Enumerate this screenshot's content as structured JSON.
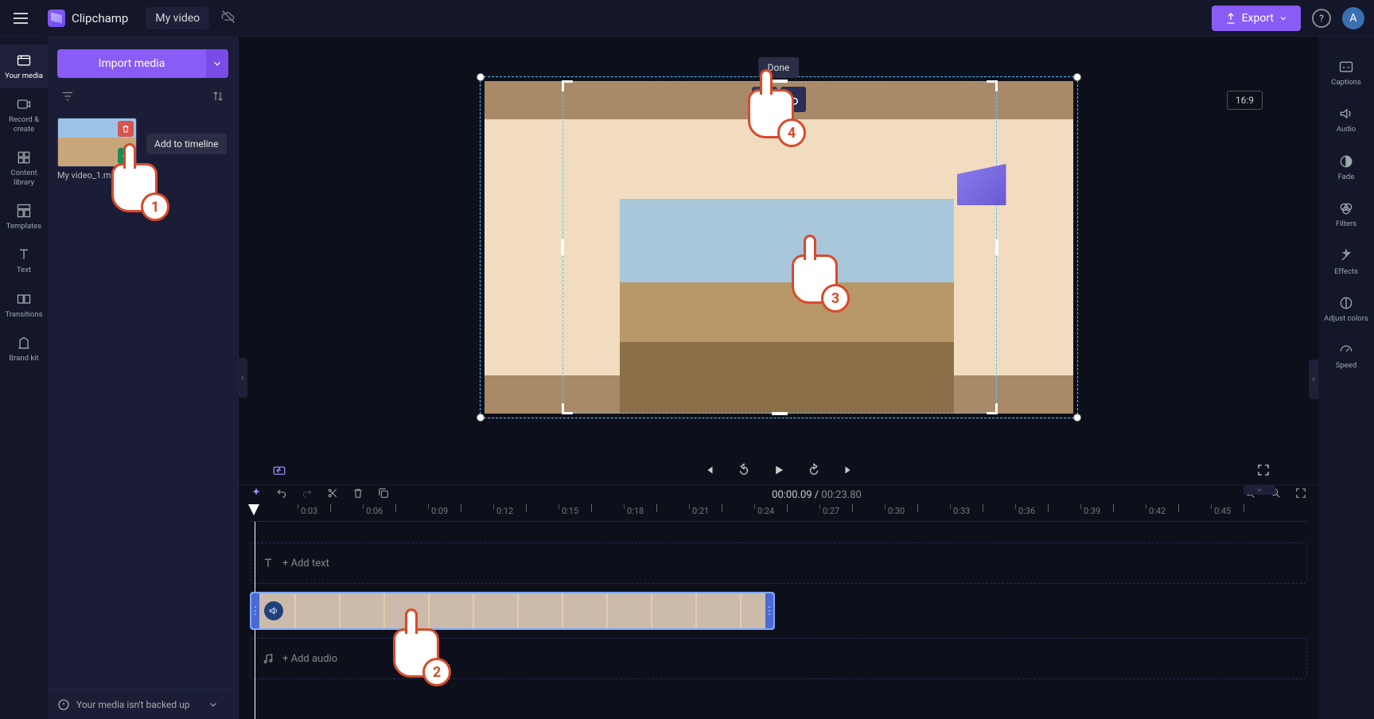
{
  "brand": "Clipchamp",
  "project": "My video",
  "done_tooltip": "Done",
  "export_label": "Export",
  "avatar_initial": "A",
  "navrail": [
    {
      "label": "Your media",
      "id": "your-media"
    },
    {
      "label": "Record & create",
      "id": "record-create"
    },
    {
      "label": "Content library",
      "id": "content-library"
    },
    {
      "label": "Templates",
      "id": "templates"
    },
    {
      "label": "Text",
      "id": "text"
    },
    {
      "label": "Transitions",
      "id": "transitions"
    },
    {
      "label": "Brand kit",
      "id": "brand-kit"
    }
  ],
  "import_label": "Import media",
  "media_item_name": "My video_1.m…",
  "add_to_timeline_tip": "Add to timeline",
  "backup_message": "Your media isn't backed up",
  "aspect_ratio": "16:9",
  "current_time": "00:00.09",
  "total_time": "00:23.80",
  "ruler_ticks": [
    "0:03",
    "0:06",
    "0:09",
    "0:12",
    "0:15",
    "0:18",
    "0:21",
    "0:24",
    "0:27",
    "0:30",
    "0:33",
    "0:36",
    "0:39",
    "0:42",
    "0:45"
  ],
  "track_add_text": "+ Add text",
  "track_add_audio": "+ Add audio",
  "right_rail": [
    {
      "label": "Captions",
      "id": "captions"
    },
    {
      "label": "Audio",
      "id": "audio"
    },
    {
      "label": "Fade",
      "id": "fade"
    },
    {
      "label": "Filters",
      "id": "filters"
    },
    {
      "label": "Effects",
      "id": "effects"
    },
    {
      "label": "Adjust colors",
      "id": "adjust-colors"
    },
    {
      "label": "Speed",
      "id": "speed"
    }
  ],
  "steps": {
    "1": "1",
    "2": "2",
    "3": "3",
    "4": "4"
  }
}
